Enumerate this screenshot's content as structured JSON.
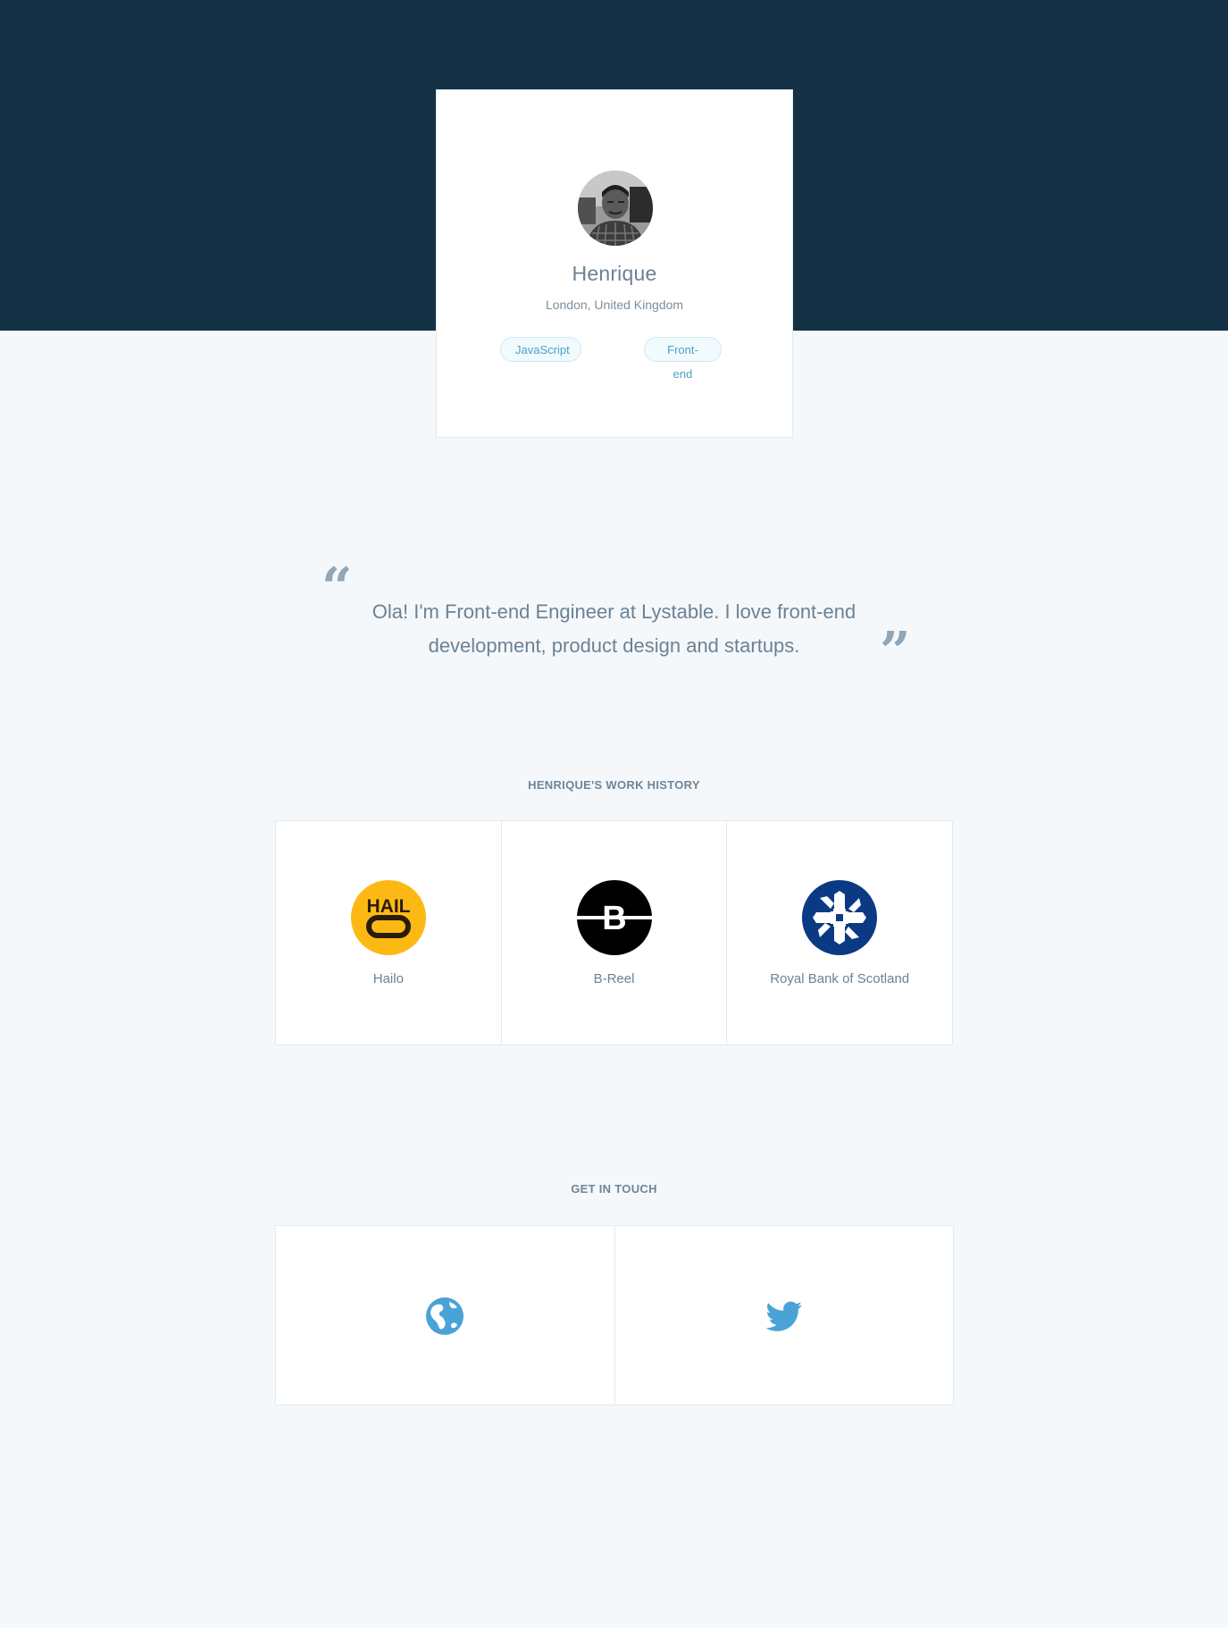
{
  "profile": {
    "name": "Henrique",
    "location": "London, United Kingdom",
    "tags": [
      "JavaScript",
      "Front-end"
    ]
  },
  "quote": {
    "open_mark": "“",
    "close_mark": "”",
    "text": "Ola! I'm Front-end Engineer at Lystable. I love front-end development, product design and startups."
  },
  "work_history": {
    "heading": "HENRIQUE'S WORK HISTORY",
    "companies": [
      {
        "name": "Hailo",
        "logo": "hailo-logo",
        "logo_text": "HAIL",
        "color": "#fdb913"
      },
      {
        "name": "B-Reel",
        "logo": "breel-logo",
        "logo_text": "B",
        "color": "#000000"
      },
      {
        "name": "Royal Bank of Scotland",
        "logo": "rbs-logo",
        "color": "#0a3a84"
      }
    ]
  },
  "contact": {
    "heading": "GET IN TOUCH",
    "links": [
      {
        "icon": "globe-icon",
        "color": "#4aa3d6"
      },
      {
        "icon": "twitter-icon",
        "color": "#4aa3d6"
      }
    ]
  },
  "colors": {
    "hero_background": "#143045",
    "page_background": "#f4f8fb",
    "accent": "#4aa3c6"
  }
}
